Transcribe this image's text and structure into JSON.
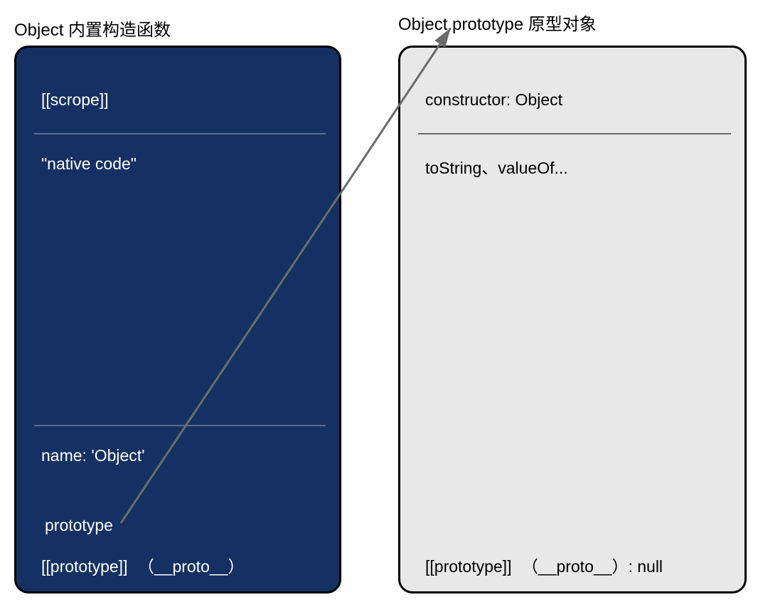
{
  "titles": {
    "left": "Object 内置构造函数",
    "right": "Object.prototype 原型对象"
  },
  "leftBox": {
    "scope": "[[scrope]]",
    "nativeCode": "\"native code\"",
    "name": "name: 'Object'",
    "prototype": "prototype",
    "protoInternal": "[[prototype]]",
    "protoDunder": "（__proto__）"
  },
  "rightBox": {
    "constructor": "constructor: Object",
    "methods": "toString、valueOf...",
    "protoInternal": "[[prototype]]",
    "protoDunder": "（__proto__）: null"
  },
  "colors": {
    "leftBoxBg": "#153163",
    "rightBoxBg": "#e8e8e8",
    "arrow": "#6b6b6b"
  }
}
